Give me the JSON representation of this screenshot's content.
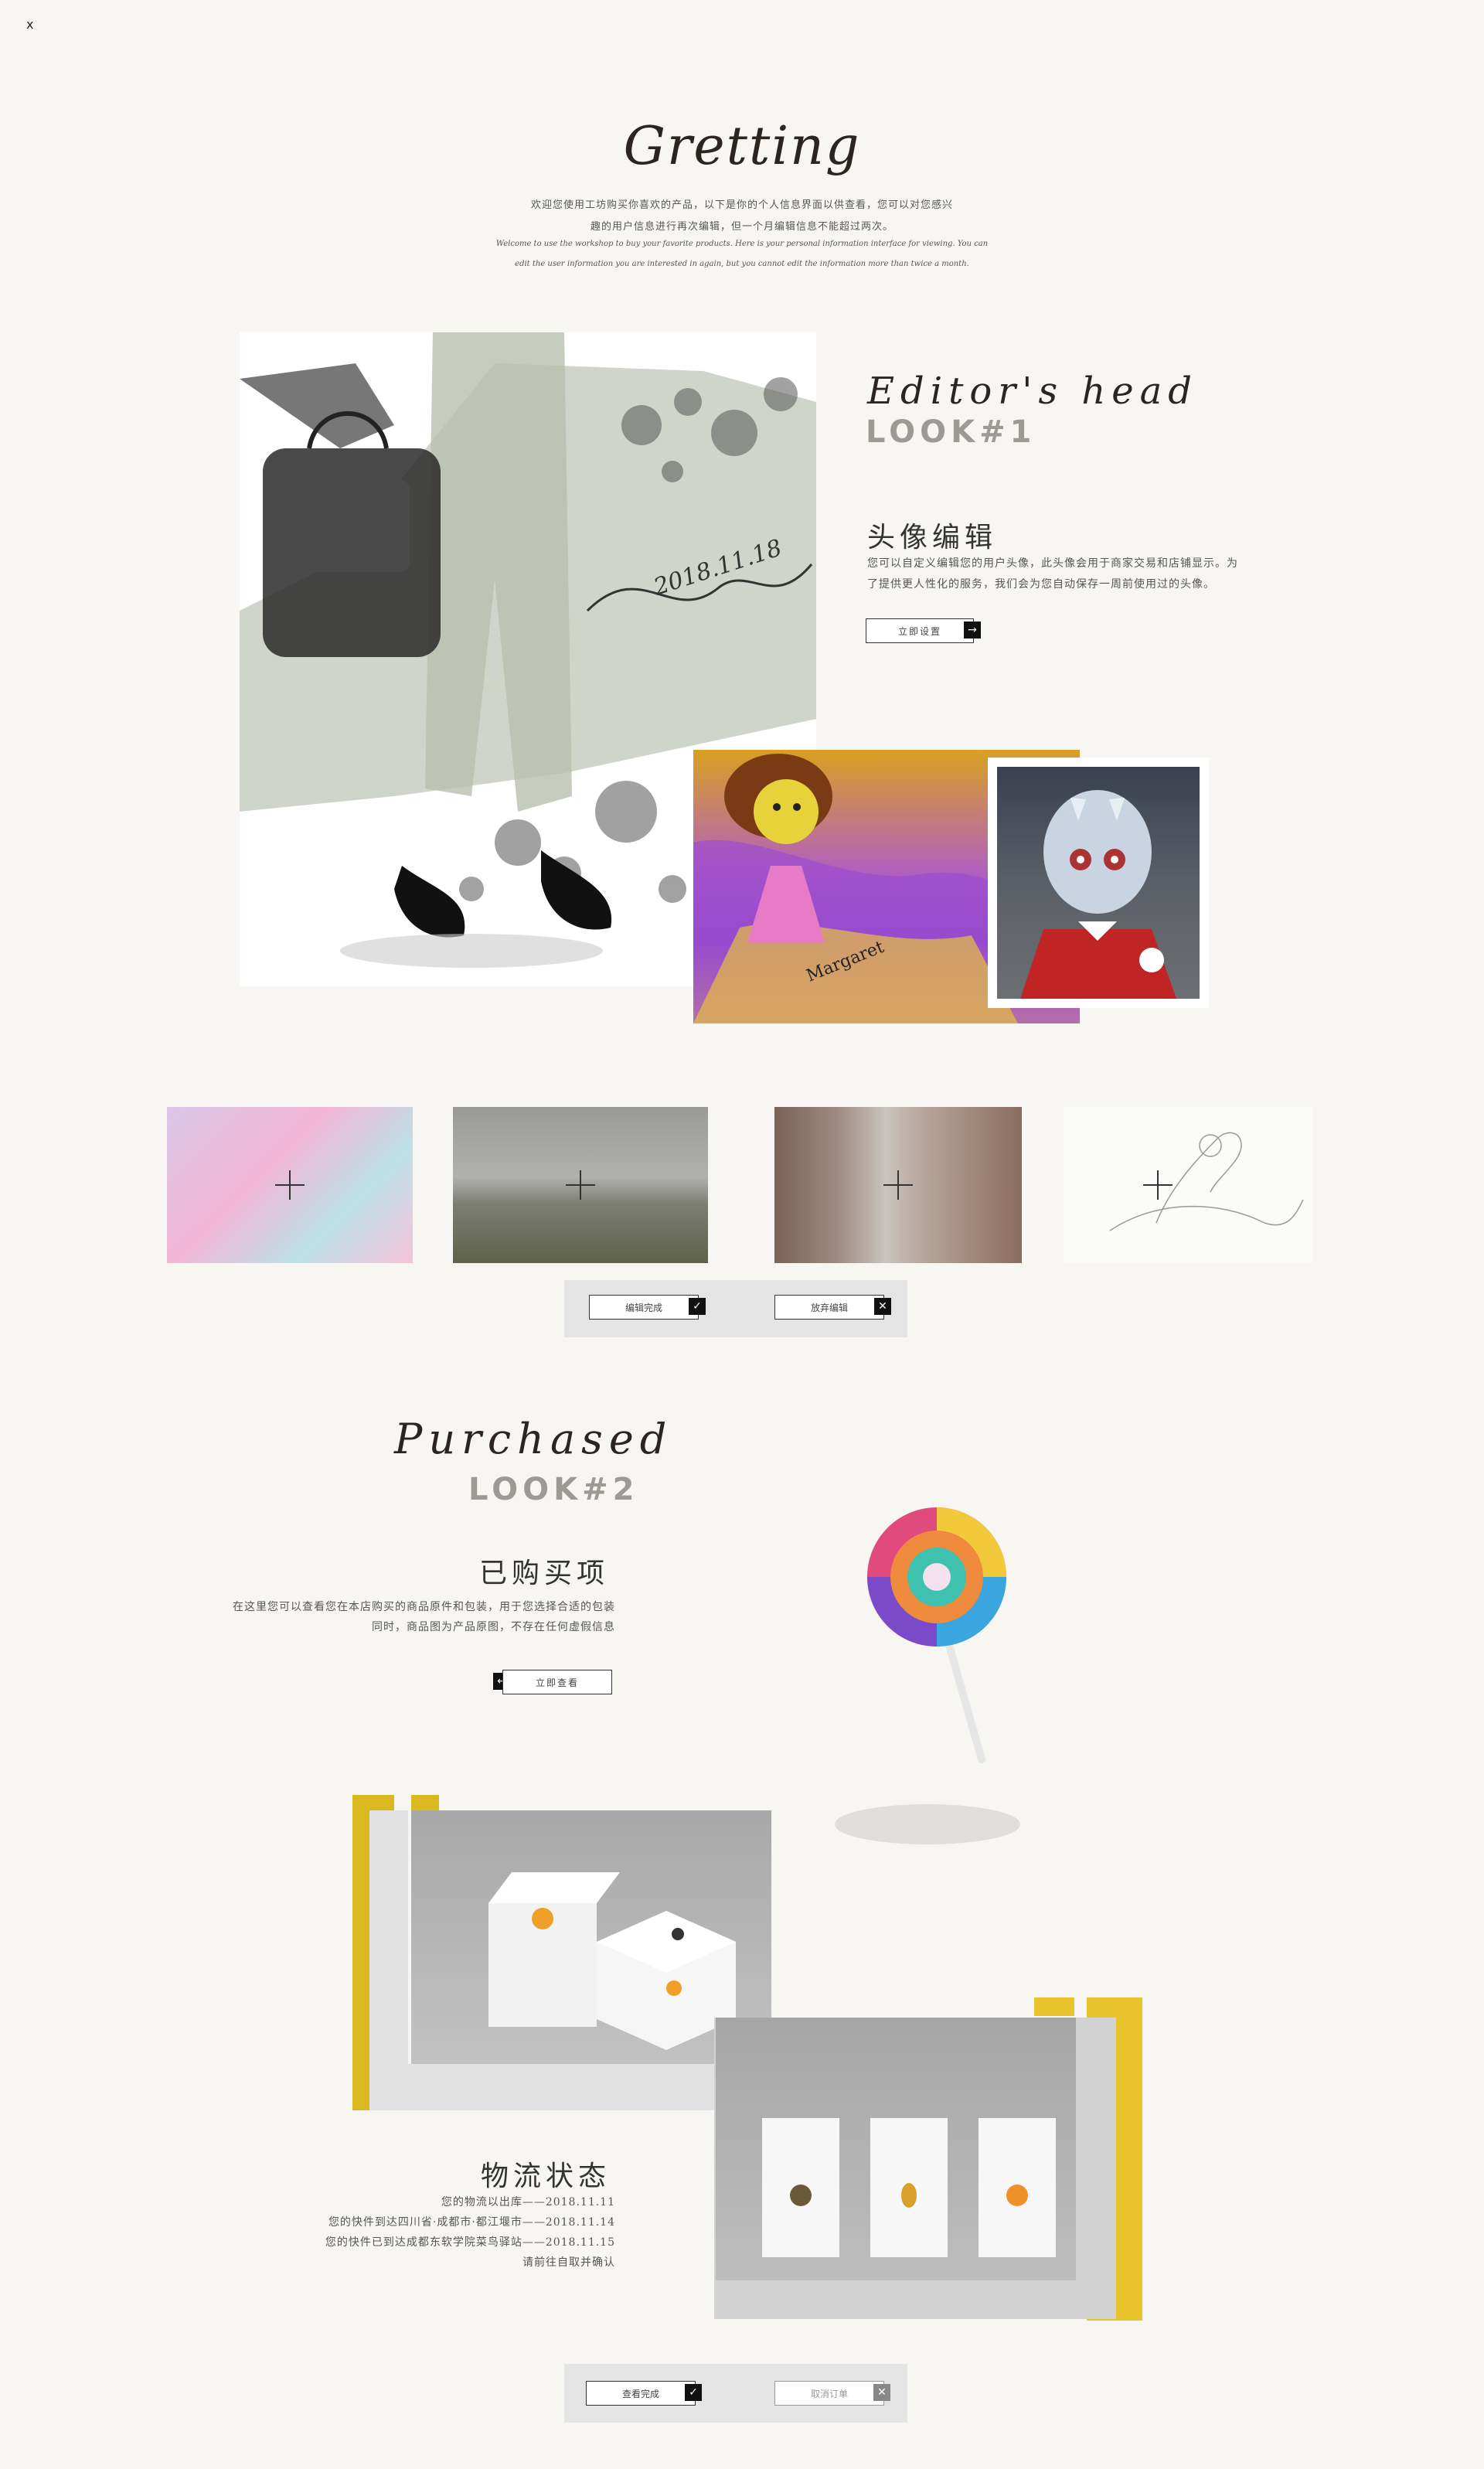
{
  "close": "x",
  "greeting": {
    "title": "Gretting",
    "line1": "欢迎您使用工坊购买你喜欢的产品，以下是你的个人信息界面以供查看，您可以对您感兴",
    "line2": "趣的用户信息进行再次编辑，但一个月编辑信息不能超过两次。",
    "en1": "Welcome to use the workshop to buy your favorite products. Here is your personal information interface for viewing. You can",
    "en2": "edit the user information you are interested in again, but you cannot edit the information more than twice a month."
  },
  "editor": {
    "title": "Editor's head",
    "look": "LOOK#1",
    "cn_title": "头像编辑",
    "desc1": "您可以自定义编辑您的用户头像，此头像会用于商家交易和店铺显示。为",
    "desc2": "了提供更人性化的服务，我们会为您自动保存一周前使用过的头像。",
    "button": "立即设置",
    "button_icon": "→",
    "signature": "2018.11.18",
    "card_name": "Margaret"
  },
  "thumbs_actions": {
    "done": "编辑完成",
    "done_icon": "✓",
    "cancel": "放弃编辑",
    "cancel_icon": "✕"
  },
  "purchased": {
    "title": "Purchased",
    "look": "LOOK#2",
    "cn_title": "已购买项",
    "desc1": "在这里您可以查看您在本店购买的商品原件和包装，用于您选择合适的包装",
    "desc2": "同时，商品图为产品原图，不存在任何虚假信息",
    "button": "立即查看",
    "button_icon": "←"
  },
  "logistics": {
    "title": "物流状态",
    "lines": [
      "您的物流以出库——2018.11.11",
      "您的快件到达四川省·成都市·都江堰市——2018.11.14",
      "您的快件已到达成都东软学院菜鸟驿站——2018.11.15",
      "请前往自取并确认"
    ]
  },
  "bottom_actions": {
    "view_done": "查看完成",
    "view_icon": "✓",
    "cancel_order": "取消订单",
    "cancel_icon": "✕"
  },
  "colors": {
    "background": "#f7f6f3",
    "accent_yellow": "#d9b820",
    "panel_grey": "#e4e4e4",
    "look_grey": "#9d9a96"
  }
}
